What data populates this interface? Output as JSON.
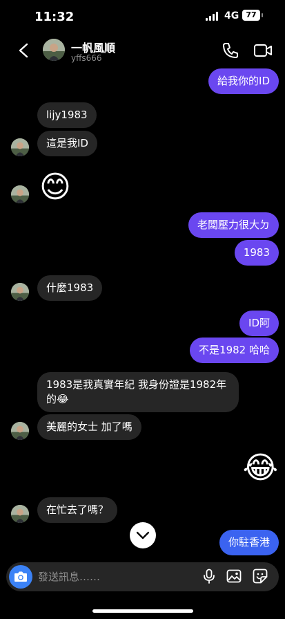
{
  "status_bar": {
    "time": "11:32",
    "network": "4G",
    "battery": "77"
  },
  "header": {
    "name": "一帆風順",
    "username": "yffs666"
  },
  "messages": [
    {
      "text": "給我你的ID"
    },
    {
      "text": "lijy1983"
    },
    {
      "text": "這是我ID"
    },
    {
      "text": "😊"
    },
    {
      "text": "老闆壓力很大ㄉ"
    },
    {
      "text": "1983"
    },
    {
      "text": "什麼1983"
    },
    {
      "text": "ID阿"
    },
    {
      "text": "不是1982 哈哈"
    },
    {
      "text": "1983是我真實年紀 我身份證是1982年的😂"
    },
    {
      "text": "美麗的女士  加了嗎"
    },
    {
      "text": "😂"
    },
    {
      "text": "在忙去了嗎？"
    },
    {
      "text": "你駐香港"
    }
  ],
  "composer": {
    "placeholder": "發送訊息……"
  },
  "colors": {
    "outgoing_bubble": "#6a47f0",
    "incoming_bubble": "#262626",
    "camera_button": "#3b82f6"
  }
}
